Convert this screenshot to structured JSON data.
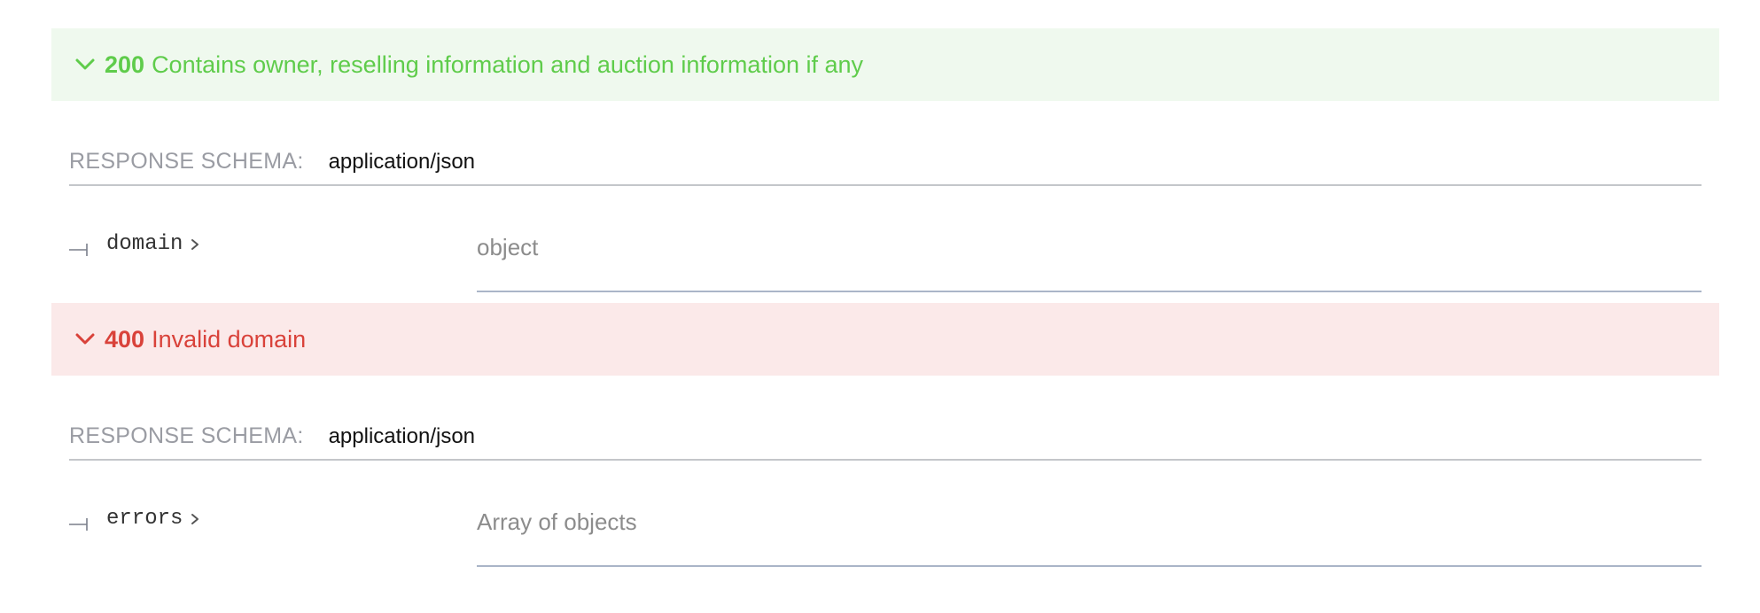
{
  "responses": [
    {
      "code": "200",
      "description": "Contains owner, reselling information and auction information if any",
      "status": "success",
      "schema_label": "RESPONSE SCHEMA:",
      "schema_type": "application/json",
      "property": {
        "name": "domain",
        "type": "object"
      }
    },
    {
      "code": "400",
      "description": "Invalid domain",
      "status": "error",
      "schema_label": "RESPONSE SCHEMA:",
      "schema_type": "application/json",
      "property": {
        "name": "errors",
        "type": "Array of objects"
      }
    }
  ],
  "icons": {
    "expand": "chevron-down-icon",
    "tree": "tree-branch-icon",
    "property_expand": "chevron-right-icon"
  },
  "colors": {
    "success_text": "#5fcc4b",
    "success_bg": "#eff9ee",
    "error_text": "#d9423a",
    "error_bg": "#fbe9e9",
    "muted_text": "#9a9ca3",
    "divider": "#c4c6ca"
  }
}
